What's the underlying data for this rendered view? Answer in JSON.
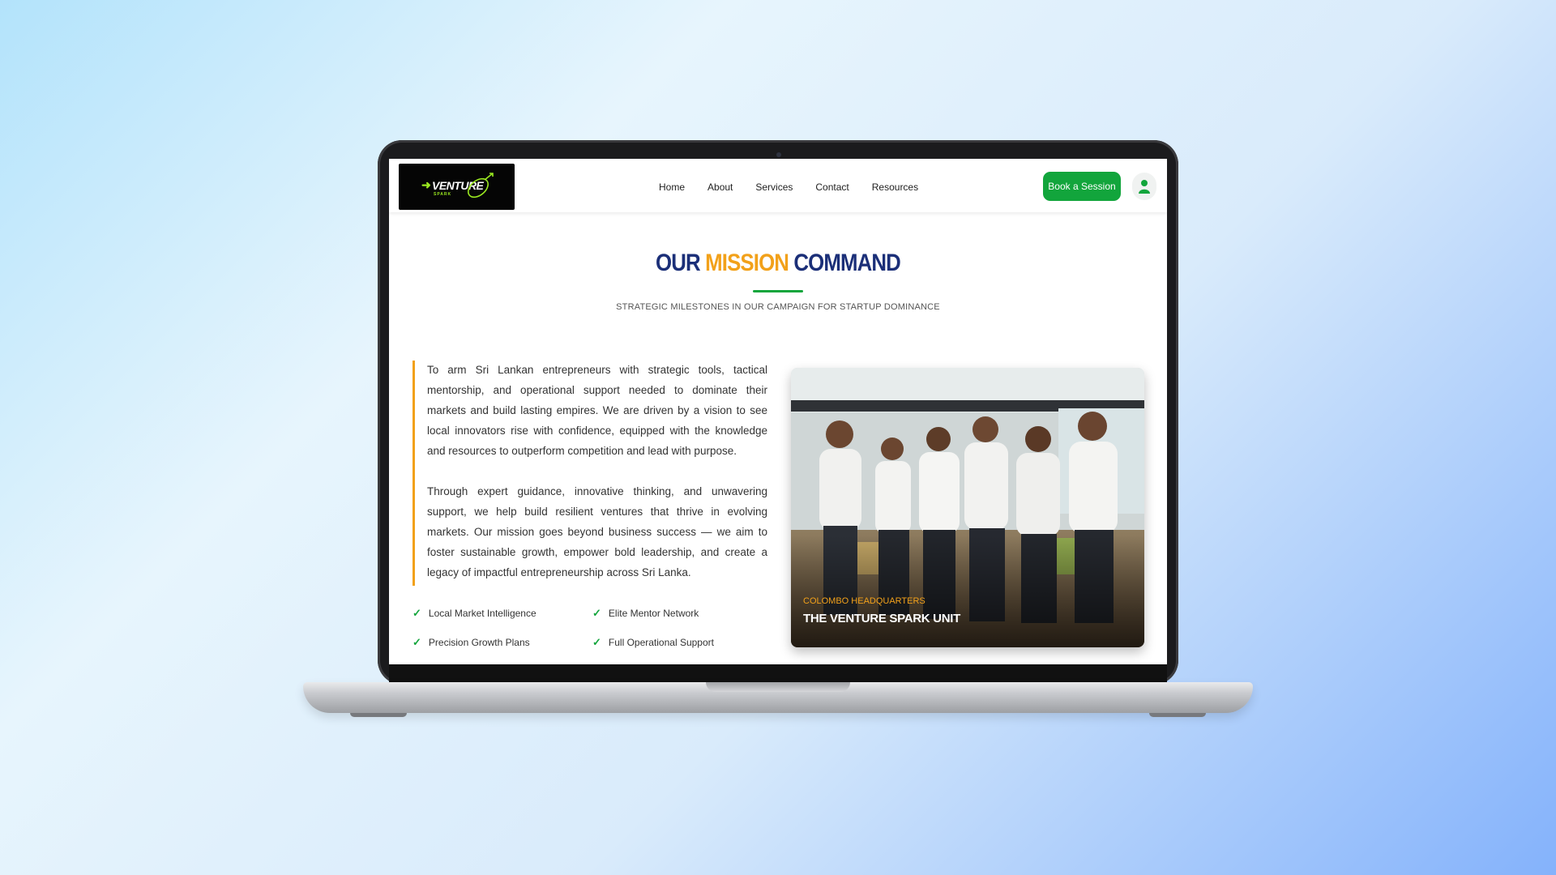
{
  "nav": {
    "logo_text": "VENTURE",
    "logo_sub": "SPARK",
    "links": [
      "Home",
      "About",
      "Services",
      "Contact",
      "Resources"
    ],
    "cta_label": "Book a Session",
    "user_icon": "user-icon"
  },
  "hero": {
    "title_part1": "OUR",
    "title_accent": "MISSION",
    "title_part2": "COMMAND",
    "subtitle": "STRATEGIC MILESTONES IN OUR CAMPAIGN FOR STARTUP DOMINANCE"
  },
  "mission": {
    "paragraphs": [
      "To arm Sri Lankan entrepreneurs with strategic tools, tactical mentorship, and operational support needed to dominate their markets and build lasting empires. We are driven by a vision to see local innovators rise with confidence, equipped with the knowledge and resources to outperform competition and lead with purpose.",
      "Through expert guidance, innovative thinking, and unwavering support, we help build resilient ventures that thrive in evolving markets. Our mission goes beyond business success — we aim to foster sustainable growth, empower bold leadership, and create a legacy of impactful entrepreneurship across Sri Lanka."
    ],
    "features": [
      "Local Market Intelligence",
      "Elite Mentor Network",
      "Precision Growth Plans",
      "Full Operational Support"
    ]
  },
  "photo": {
    "kicker": "COLOMBO HEADQUARTERS",
    "title": "THE VENTURE SPARK UNIT"
  },
  "colors": {
    "brand_green": "#12a53c",
    "accent_orange": "#f2a11a",
    "navy": "#1b2f78"
  }
}
